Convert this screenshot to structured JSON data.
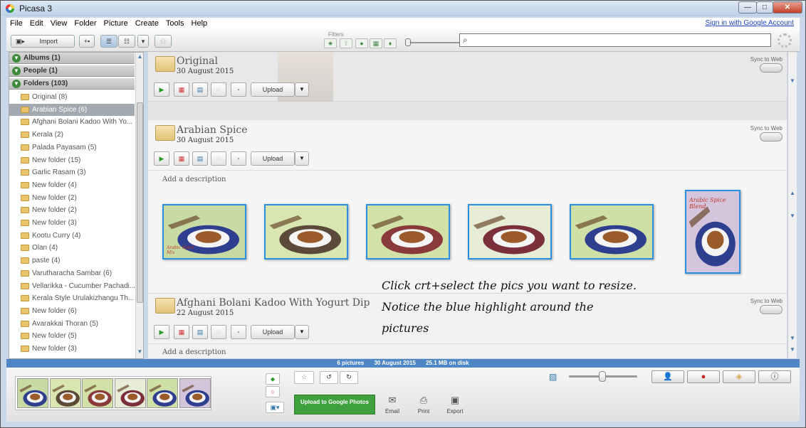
{
  "window": {
    "title": "Picasa 3",
    "min_label": "—",
    "max_label": "□",
    "close_label": "✕"
  },
  "menu": {
    "items": [
      "File",
      "Edit",
      "View",
      "Folder",
      "Picture",
      "Create",
      "Tools",
      "Help"
    ],
    "signin": "Sign in with Google Account"
  },
  "toolbar": {
    "import_label": "Import",
    "filters_label": "Filters",
    "search_placeholder": ""
  },
  "sidebar": {
    "sections": [
      {
        "label": "Albums (1)"
      },
      {
        "label": "People (1)"
      },
      {
        "label": "Folders (103)"
      }
    ],
    "folders": [
      {
        "label": "Original (8)",
        "selected": false
      },
      {
        "label": "Arabian Spice (6)",
        "selected": true
      },
      {
        "label": "Afghani Bolani Kadoo With Yo...",
        "selected": false
      },
      {
        "label": "Kerala (2)",
        "selected": false
      },
      {
        "label": "Palada Payasam (5)",
        "selected": false
      },
      {
        "label": "New folder (15)",
        "selected": false
      },
      {
        "label": "Garlic Rasam (3)",
        "selected": false
      },
      {
        "label": "New folder (4)",
        "selected": false
      },
      {
        "label": "New folder (2)",
        "selected": false
      },
      {
        "label": "New folder (2)",
        "selected": false
      },
      {
        "label": "New folder (3)",
        "selected": false
      },
      {
        "label": "Kootu Curry (4)",
        "selected": false
      },
      {
        "label": "Olan (4)",
        "selected": false
      },
      {
        "label": "paste (4)",
        "selected": false
      },
      {
        "label": "Varutharacha Sambar (6)",
        "selected": false
      },
      {
        "label": "Vellarikka - Cucumber Pachadi...",
        "selected": false
      },
      {
        "label": "Kerala Style Urulakizhangu Th...",
        "selected": false
      },
      {
        "label": "New folder (6)",
        "selected": false
      },
      {
        "label": "Avarakkai Thoran (5)",
        "selected": false
      },
      {
        "label": "New folder (5)",
        "selected": false
      },
      {
        "label": "New folder (3)",
        "selected": false
      }
    ]
  },
  "albums": [
    {
      "title": "Original",
      "date": "30 August 2015",
      "sync_label": "Sync to Web",
      "upload_label": "Upload"
    },
    {
      "title": "Arabian Spice",
      "date": "30 August 2015",
      "sync_label": "Sync to Web",
      "upload_label": "Upload",
      "description": "Add a description"
    },
    {
      "title": "Afghani Bolani Kadoo With Yogurt Dip",
      "date": "22 August 2015",
      "sync_label": "Sync to Web",
      "upload_label": "Upload",
      "description": "Add a description"
    }
  ],
  "photos": [
    {
      "caption": "Arabic Spice Mix",
      "bg": "#c9dba4",
      "plate": "#2f3f8f"
    },
    {
      "caption": "",
      "bg": "#d9e6b2",
      "plate": "#5b4a3a"
    },
    {
      "caption": "",
      "bg": "#d2e1a8",
      "plate": "#8a3a3a"
    },
    {
      "caption": "",
      "bg": "#e7ecd6",
      "plate": "#7a2f3a"
    },
    {
      "caption": "",
      "bg": "#cfe0a6",
      "plate": "#2f3f8f"
    },
    {
      "caption": "Arabic Spice Blend",
      "bg": "#d4c4dc",
      "plate": "#2f3f8f"
    }
  ],
  "annotation": {
    "line1": "Click crt+select the pics you want to resize.",
    "line2": "Notice the blue highlight around the",
    "line3": "pictures"
  },
  "status": {
    "count": "6 pictures",
    "date": "30 August 2015",
    "size": "25.1 MB on disk"
  },
  "bottom": {
    "upload_google": "Upload to Google Photos",
    "email": "Email",
    "print": "Print",
    "export": "Export"
  }
}
